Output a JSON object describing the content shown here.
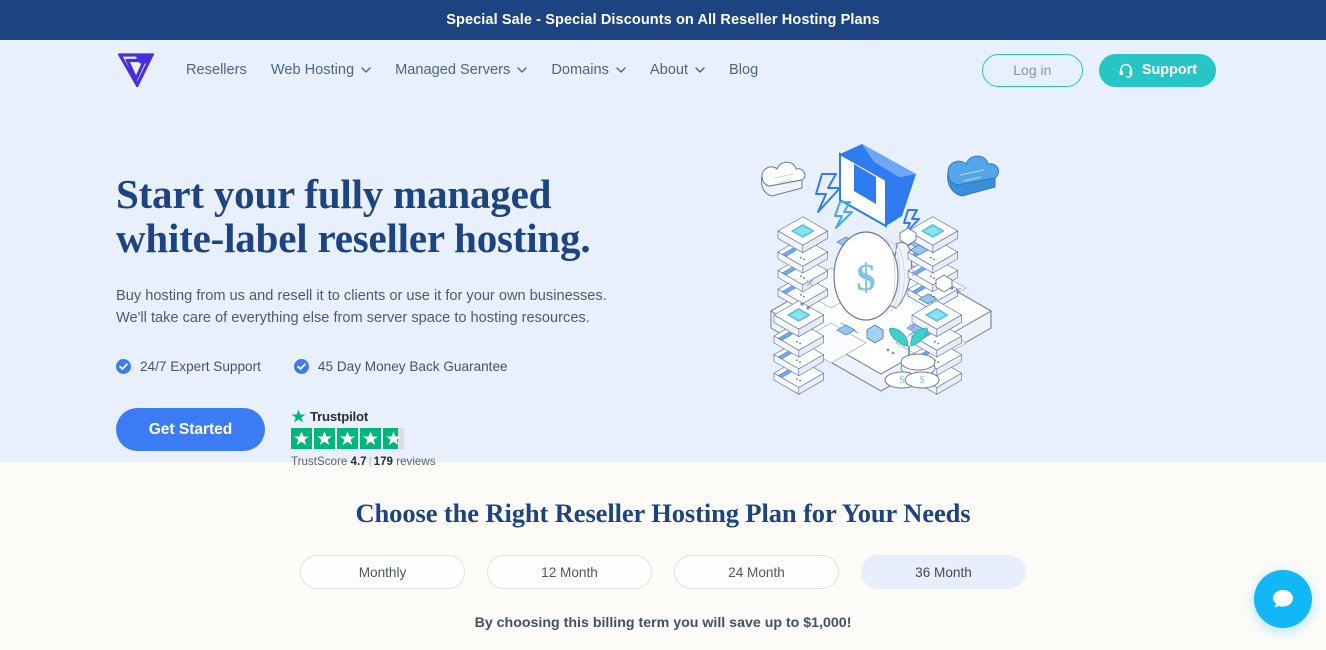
{
  "announcement": {
    "text": "Special Sale - Special Discounts on All Reseller Hosting Plans",
    "bg_color": "#1d4480"
  },
  "header": {
    "logo_name": "verpex-logo",
    "nav": [
      {
        "label": "Resellers",
        "has_dropdown": false
      },
      {
        "label": "Web Hosting",
        "has_dropdown": true
      },
      {
        "label": "Managed Servers",
        "has_dropdown": true
      },
      {
        "label": "Domains",
        "has_dropdown": true
      },
      {
        "label": "About",
        "has_dropdown": true
      },
      {
        "label": "Blog",
        "has_dropdown": false
      }
    ],
    "login_label": "Log in",
    "support_label": "Support",
    "support_icon": "headset-icon",
    "accent_color": "#26c6c6"
  },
  "hero": {
    "title_line1": "Start your fully managed",
    "title_line2": "white-label reseller hosting.",
    "subtitle_line1": "Buy hosting from us and resell it to clients or use it for your own businesses.",
    "subtitle_line2": "We'll take care of everything else from server space to hosting resources.",
    "features": [
      {
        "label": "24/7 Expert Support",
        "icon": "check-circle-icon"
      },
      {
        "label": "45 Day Money Back Guarantee",
        "icon": "check-circle-icon"
      }
    ],
    "cta_label": "Get Started",
    "cta_color": "#3b7cf4",
    "bg_color": "#e9f0fd",
    "illustration": "isometric-datacenter-illustration"
  },
  "trustpilot": {
    "brand": "Trustpilot",
    "score_label": "TrustScore",
    "score": "4.7",
    "separator": "|",
    "reviews_count": "179",
    "reviews_label": "reviews",
    "stars_total": 5,
    "stars_filled": 4,
    "partial_fraction": 0.7,
    "star_color": "#00b67a"
  },
  "pricing": {
    "title": "Choose the Right Reseller Hosting Plan for Your Needs",
    "bg_color": "#fdfbf8",
    "billing_terms": [
      {
        "label": "Monthly",
        "active": false
      },
      {
        "label": "12 Month",
        "active": false
      },
      {
        "label": "24 Month",
        "active": false
      },
      {
        "label": "36 Month",
        "active": true
      }
    ],
    "savings_text": "By choosing this billing term you will save up to $1,000!"
  },
  "chat": {
    "icon": "chat-bubble-icon",
    "color": "#12b7f5"
  }
}
